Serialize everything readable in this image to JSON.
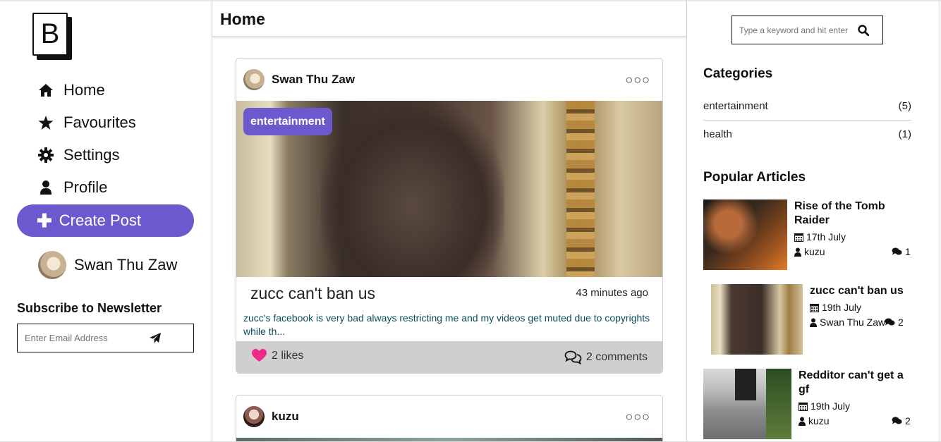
{
  "brand": {
    "logo_letter": "B"
  },
  "nav": [
    {
      "label": "Home",
      "icon": "home-icon"
    },
    {
      "label": "Favourites",
      "icon": "star-icon"
    },
    {
      "label": "Settings",
      "icon": "gear-icon"
    },
    {
      "label": "Profile",
      "icon": "user-icon"
    }
  ],
  "create_post_label": "Create Post",
  "current_user": {
    "name": "Swan Thu Zaw"
  },
  "newsletter": {
    "title": "Subscribe to Newsletter",
    "placeholder": "Enter Email Address"
  },
  "main": {
    "title": "Home",
    "posts": [
      {
        "author": "Swan Thu Zaw",
        "category": "entertainment",
        "title": "zucc can't ban us",
        "time": "43 minutes ago",
        "excerpt": "zucc's facebook is very bad always restricting me and my videos get muted due to copyrights while th...",
        "likes": "2 likes",
        "comments": "2 comments"
      },
      {
        "author": "kuzu"
      }
    ]
  },
  "search": {
    "placeholder": "Type a keyword and hit enter"
  },
  "categories": {
    "title": "Categories",
    "items": [
      {
        "name": "entertainment",
        "count": "(5)"
      },
      {
        "name": "health",
        "count": "(1)"
      }
    ]
  },
  "popular": {
    "title": "Popular Articles",
    "items": [
      {
        "title": "Rise of the Tomb Raider",
        "date": "17th July",
        "author": "kuzu",
        "comments": "1"
      },
      {
        "title": "zucc can't ban us",
        "date": "19th July",
        "author": "Swan Thu Zaw",
        "comments": "2"
      },
      {
        "title": "Redditor can't get a gf",
        "date": "19th July",
        "author": "kuzu",
        "comments": "2"
      }
    ]
  },
  "colors": {
    "accent": "#6a5acd",
    "like": "#f0288c",
    "excerpt": "#0c4b5b",
    "footer": "#cfcfcf"
  }
}
